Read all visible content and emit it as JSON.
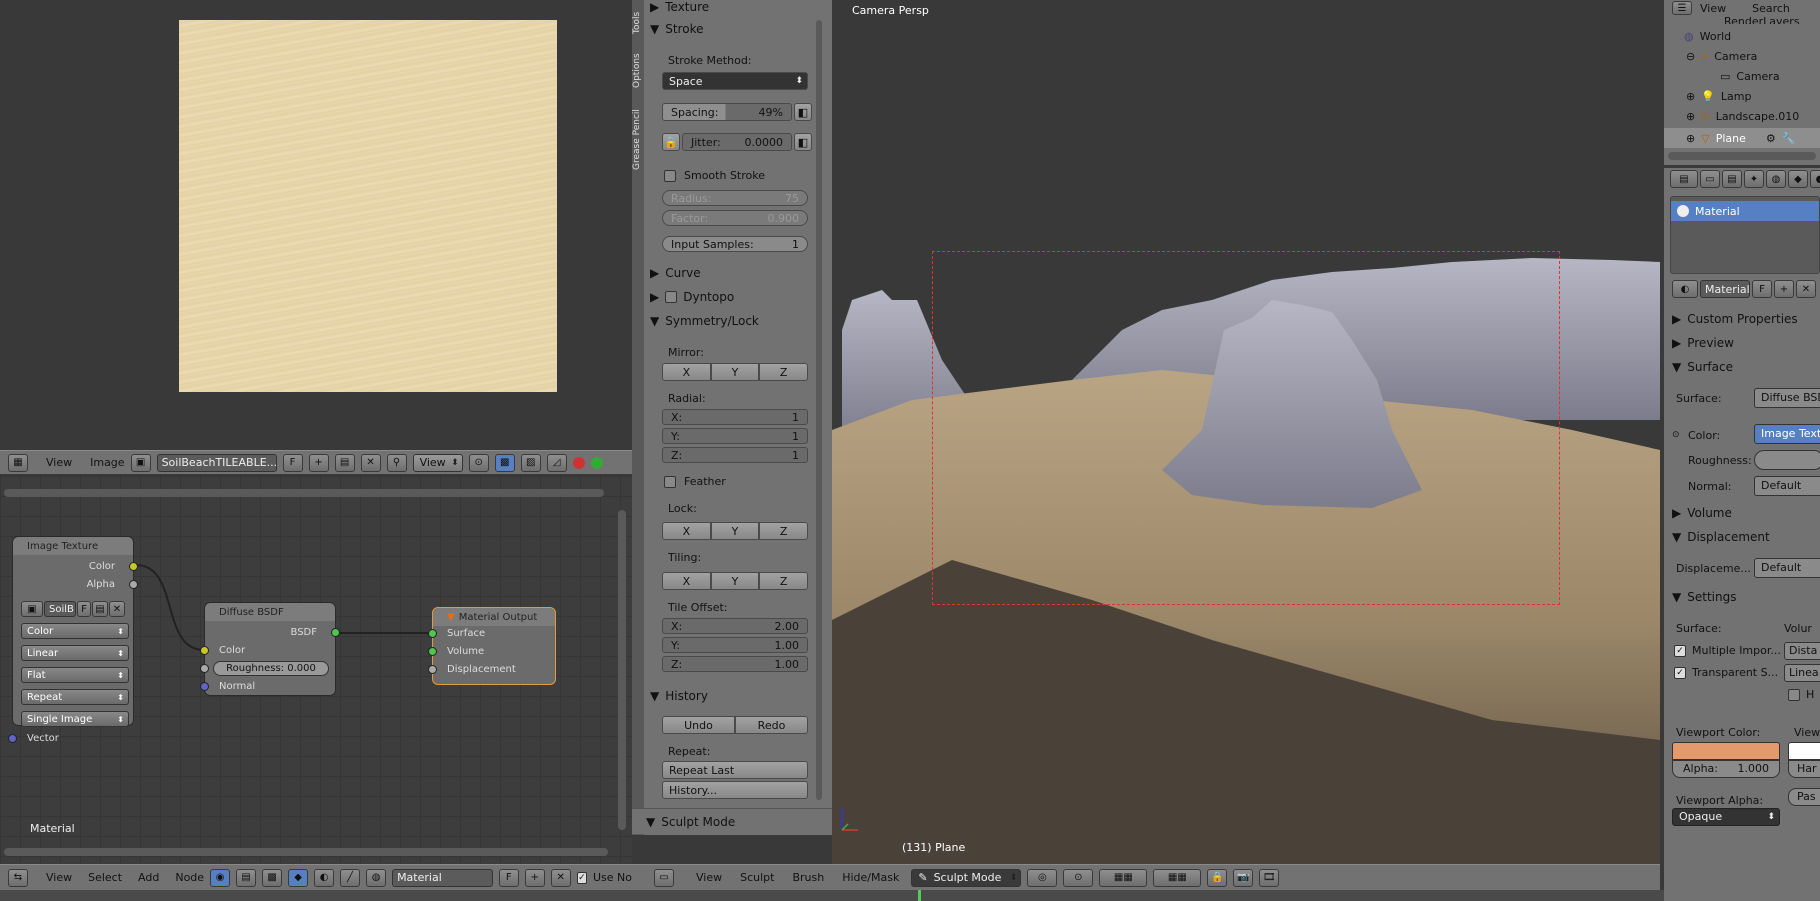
{
  "image_editor": {
    "menu_view": "View",
    "menu_image": "Image",
    "image_name": "SoilBeachTILEABLE...",
    "fake_user": "F",
    "view_mode": "View"
  },
  "node_editor": {
    "menu_view": "View",
    "menu_select": "Select",
    "menu_add": "Add",
    "menu_node": "Node",
    "material_name": "Material",
    "fake_user": "F",
    "use_nodes": "Use No",
    "footer_label": "Material",
    "image_texture": {
      "title": "Image Texture",
      "out_color": "Color",
      "out_alpha": "Alpha",
      "image_short": "SoilB",
      "fake": "F",
      "color_space": "Color",
      "interpolation": "Linear",
      "projection": "Flat",
      "extension": "Repeat",
      "source": "Single Image",
      "in_vector": "Vector"
    },
    "diffuse": {
      "title": "Diffuse BSDF",
      "out_bsdf": "BSDF",
      "in_color": "Color",
      "roughness": "Roughness: 0.000",
      "in_normal": "Normal"
    },
    "output": {
      "title": "Material Output",
      "surface": "Surface",
      "volume": "Volume",
      "displacement": "Displacement"
    }
  },
  "tool_shelf": {
    "tabs": [
      "Tools",
      "Options",
      "Grease Pencil"
    ],
    "texture": "Texture",
    "stroke": "Stroke",
    "stroke_method_label": "Stroke Method:",
    "stroke_method": "Space",
    "spacing": "Spacing:",
    "spacing_val": "49%",
    "jitter": "Jitter:",
    "jitter_val": "0.0000",
    "smooth_stroke": "Smooth Stroke",
    "radius": "Radius:",
    "radius_val": "75",
    "factor": "Factor:",
    "factor_val": "0.900",
    "input_samples": "Input Samples:",
    "input_samples_val": "1",
    "curve": "Curve",
    "dyntopo": "Dyntopo",
    "symmetry": "Symmetry/Lock",
    "mirror": "Mirror:",
    "x": "X",
    "y": "Y",
    "z": "Z",
    "radial": "Radial:",
    "radial_x": "X:",
    "radial_x_val": "1",
    "radial_y": "Y:",
    "radial_y_val": "1",
    "radial_z": "Z:",
    "radial_z_val": "1",
    "feather": "Feather",
    "lock": "Lock:",
    "tiling": "Tiling:",
    "tile_offset": "Tile Offset:",
    "to_x": "X:",
    "to_x_val": "2.00",
    "to_y": "Y:",
    "to_y_val": "1.00",
    "to_z": "Z:",
    "to_z_val": "1.00",
    "history": "History",
    "undo": "Undo",
    "redo": "Redo",
    "repeat_label": "Repeat:",
    "repeat_last": "Repeat Last",
    "history_btn": "History...",
    "sculpt_mode": "Sculpt Mode"
  },
  "viewport": {
    "title": "Camera Persp",
    "object_info": "(131) Plane",
    "menu_view": "View",
    "menu_sculpt": "Sculpt",
    "menu_brush": "Brush",
    "menu_hidemask": "Hide/Mask",
    "mode": "Sculpt Mode"
  },
  "outliner": {
    "menu_view": "View",
    "menu_search": "Search",
    "items": [
      "RenderLayers",
      "World",
      "Camera",
      "Camera",
      "Lamp",
      "Landscape.010",
      "Plane"
    ]
  },
  "properties": {
    "material_slot": "Material",
    "mat_name": "Material",
    "fake": "F",
    "custom_props": "Custom Properties",
    "preview": "Preview",
    "surface": "Surface",
    "surface_label": "Surface:",
    "surface_val": "Diffuse BSDF",
    "color_label": "Color:",
    "color_val": "Image Textu",
    "roughness_label": "Roughness:",
    "normal_label": "Normal:",
    "normal_val": "Default",
    "volume": "Volume",
    "displacement": "Displacement",
    "displacement_label": "Displaceme...",
    "displacement_val": "Default",
    "settings": "Settings",
    "settings_surface": "Surface:",
    "settings_volume": "Volur",
    "multiple_importance": "Multiple Impor...",
    "distance": "Dista",
    "transparent_shadows": "Transparent S...",
    "linear": "Linea",
    "homogeneous": "H",
    "viewport_color": "Viewport Color:",
    "viewport_spec": "Viewp",
    "alpha": "Alpha:",
    "alpha_val": "1.000",
    "hardness": "Har",
    "viewport_alpha": "Viewport Alpha:",
    "viewport_alpha_val": "Opaque",
    "pass": "Pas"
  },
  "colors": {
    "accent": "#5680c2",
    "viewport_color": "#e59a6e",
    "sand": "#e8d6ac"
  }
}
